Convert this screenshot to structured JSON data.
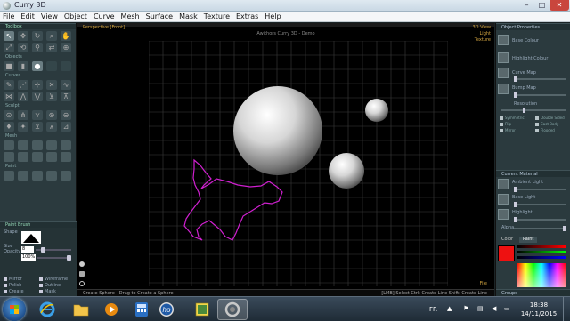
{
  "window": {
    "title": "Curry 3D",
    "controls": {
      "minimize": "–",
      "maximize": "□",
      "close": "✕"
    }
  },
  "menu": [
    "File",
    "Edit",
    "View",
    "Object",
    "Curve",
    "Mesh",
    "Surface",
    "Mask",
    "Texture",
    "Extras",
    "Help"
  ],
  "left_panel": {
    "toolbox_label": "Toolbox",
    "objects_label": "Objects",
    "curves_label": "Curves",
    "sculpt_label": "Sculpt",
    "mesh_label": "Mesh",
    "paint_label": "Paint",
    "paint_brush": {
      "header": "Paint Brush",
      "shape_label": "Shape",
      "size_label": "Size",
      "size_value": "8",
      "opacity_label": "Opacity",
      "opacity_value": "100%",
      "checkboxes": [
        "Mirror",
        "Wireframe",
        "Polish",
        "Outline",
        "Create",
        "Mask"
      ]
    }
  },
  "viewport": {
    "view_label": "Perspective [Front]",
    "center_title": "Awithors Curry 3D - Demo",
    "right_labels": [
      "3D View",
      "Light",
      "Texture"
    ],
    "file_label": "File",
    "status_hint": "Create Sphere - Drag to Create a Sphere",
    "status_right": "[LMB] Select   Ctrl: Create Line   Shift: Create Line",
    "grid_color": "#3c3c3c",
    "scribble_color": "#d020d0"
  },
  "right_panel": {
    "object_properties": "Object Properties",
    "base_colour": "Base Colour",
    "highlight_colour": "Highlight Colour",
    "curve_map": "Curve Map",
    "bump_map": "Bump Map",
    "resolution": "Resolution",
    "checkboxes": [
      "Symmetric",
      "Double Sided",
      "Flip",
      "Cast Body",
      "Mirror",
      "Flooded"
    ],
    "current_material": "Current Material",
    "ambient_light": "Ambient Light",
    "base_light": "Base Light",
    "highlight": "Highlight",
    "alpha": "Alpha",
    "color_tab": "Color",
    "paint_tab": "Paint",
    "current_color": "#ee1111",
    "groups_label": "Groups"
  },
  "taskbar": {
    "items": [
      "ie-icon",
      "folder-icon",
      "media-player-icon",
      "calculator-icon",
      "hp-icon",
      "image-viewer-icon",
      "curry3d-icon"
    ],
    "language": "FR",
    "time": "18:38",
    "date": "14/11/2015"
  }
}
